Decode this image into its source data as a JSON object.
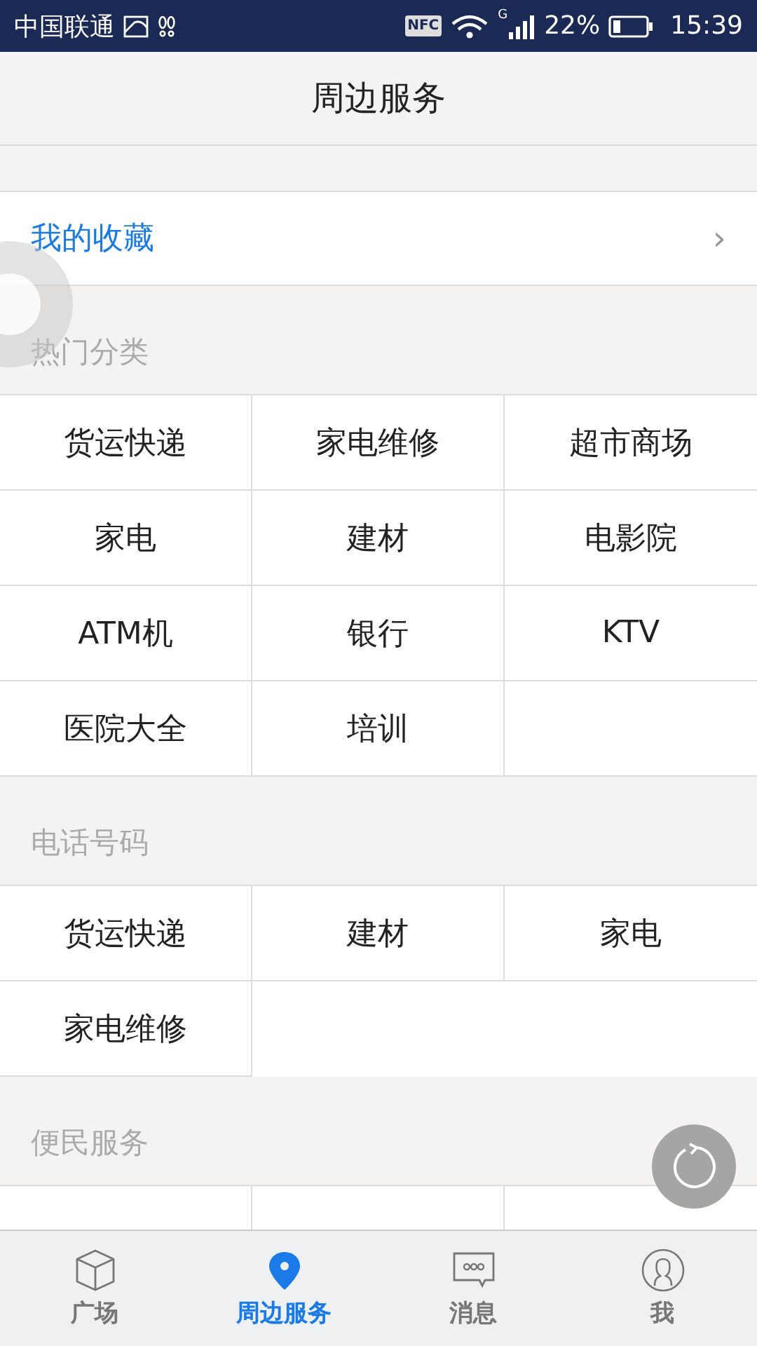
{
  "status_bar": {
    "carrier": "中国联通",
    "nfc": "NFC",
    "network": "G",
    "battery": "22%",
    "time": "15:39"
  },
  "header": {
    "title": "周边服务"
  },
  "favorites": {
    "label": "我的收藏",
    "chevron": "›"
  },
  "sections": [
    {
      "title": "热门分类",
      "items": [
        "货运快递",
        "家电维修",
        "超市商场",
        "家电",
        "建材",
        "电影院",
        "ATM机",
        "银行",
        "KTV",
        "医院大全",
        "培训"
      ]
    },
    {
      "title": "电话号码",
      "items": [
        "货运快递",
        "建材",
        "家电",
        "家电维修"
      ]
    },
    {
      "title": "便民服务"
    }
  ],
  "tabs": [
    {
      "label": "广场",
      "selected": false
    },
    {
      "label": "周边服务",
      "selected": true
    },
    {
      "label": "消息",
      "selected": false
    },
    {
      "label": "我",
      "selected": false
    }
  ]
}
